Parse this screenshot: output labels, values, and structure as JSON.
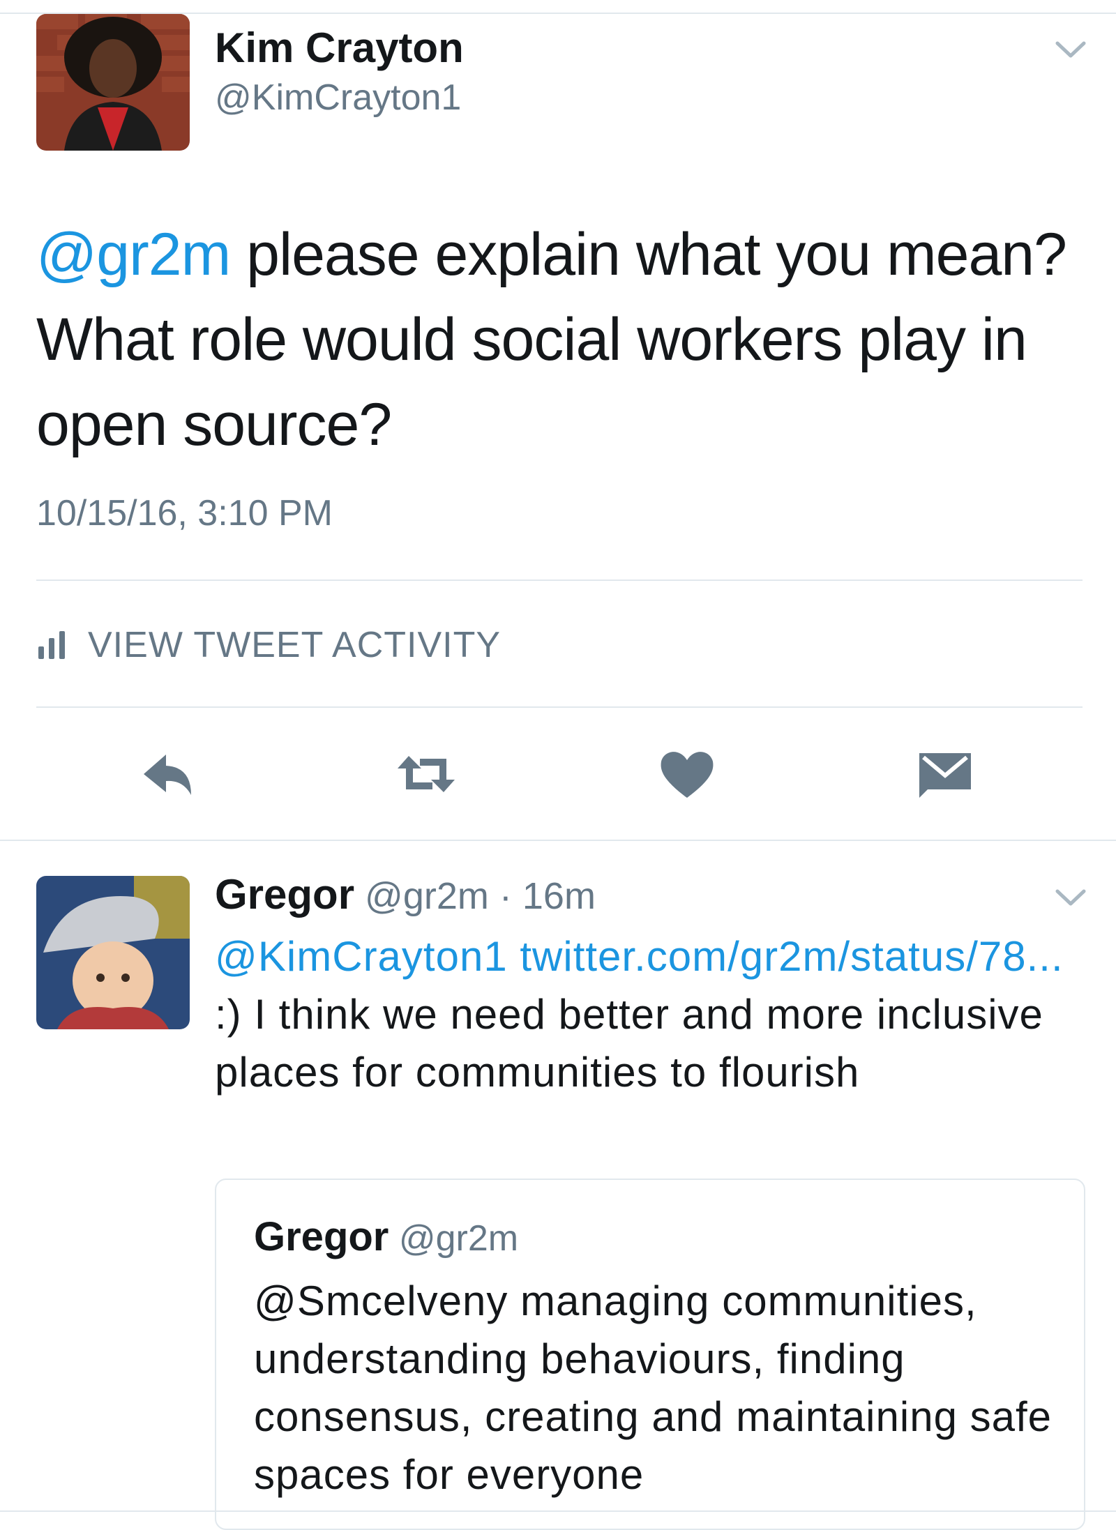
{
  "main_tweet": {
    "name": "Kim Crayton",
    "handle": "@KimCrayton1",
    "text_mention": "@gr2m",
    "text_body": " please explain what you mean? What role would social workers play in open source?",
    "timestamp": "10/15/16, 3:10 PM",
    "activity_label": "VIEW TWEET ACTIVITY"
  },
  "actions": [
    "reply-icon",
    "retweet-icon",
    "heart-icon",
    "message-icon"
  ],
  "reply": {
    "name": "Gregor",
    "meta": " @gr2m · 16m",
    "mention": "@KimCrayton1",
    "link": "twitter.com/gr2m/status/78...",
    "text": " :) I think we need better and more inclusive places for communities to flourish"
  },
  "quote": {
    "name": "Gregor",
    "handle": " @gr2m",
    "text": "@Smcelveny managing communities, understanding behaviours, finding consensus, creating and maintaining safe spaces for everyone"
  },
  "colors": {
    "link": "#1b95e0",
    "secondary_text": "#657786",
    "divider": "#e1e8ed",
    "icon": "#657786"
  }
}
